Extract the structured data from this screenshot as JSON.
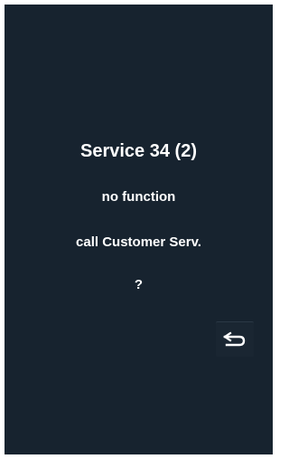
{
  "screen": {
    "title": "Service 34 (2)",
    "lines": [
      "no function",
      "call Customer Serv.",
      "?"
    ],
    "back_button": {
      "icon": "return-arrow-icon"
    }
  },
  "colors": {
    "screen_background": "#17232f",
    "text": "#ffffff",
    "bezel": "#ffffff"
  }
}
